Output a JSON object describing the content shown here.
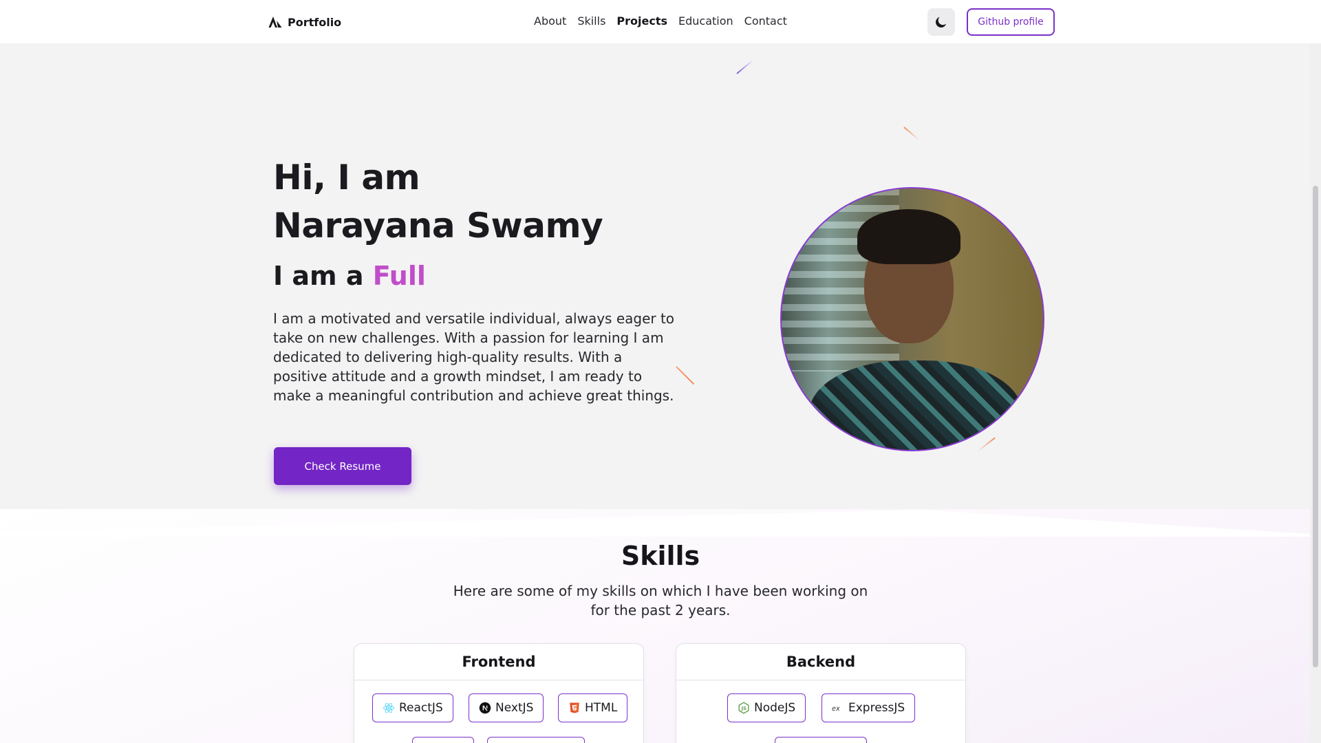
{
  "navbar": {
    "brand": "Portfolio",
    "links": [
      {
        "label": "About"
      },
      {
        "label": "Skills"
      },
      {
        "label": "Projects"
      },
      {
        "label": "Education"
      },
      {
        "label": "Contact"
      }
    ],
    "active_link": "Projects",
    "theme_icon": "moon-icon",
    "github_label": "Github profile"
  },
  "hero": {
    "greeting_line1": "Hi, I am",
    "greeting_line2": "Narayana Swamy",
    "role_prefix": "I am a ",
    "role_highlight": "Full",
    "bio": "I am a motivated and versatile individual, always eager to take on new challenges. With a passion for learning I am dedicated to delivering high-quality results. With a positive attitude and a growth mindset, I am ready to make a meaningful contribution and achieve great things.",
    "resume_button": "Check Resume"
  },
  "skills": {
    "title": "Skills",
    "description": "Here are some of my skills on which I have been working on for the past 2 years.",
    "categories": [
      {
        "title": "Frontend",
        "items": [
          {
            "label": "ReactJS",
            "icon": "react-icon"
          },
          {
            "label": "NextJS",
            "icon": "nextjs-icon"
          },
          {
            "label": "HTML",
            "icon": "html5-icon"
          }
        ]
      },
      {
        "title": "Backend",
        "items": [
          {
            "label": "NodeJS",
            "icon": "nodejs-icon"
          },
          {
            "label": "ExpressJS",
            "icon": "expressjs-icon"
          }
        ]
      }
    ]
  },
  "colors": {
    "accent": "#7325c5",
    "highlight": "#c04ec9",
    "text": "#1a1a1f",
    "background": "#f3f3f3"
  }
}
